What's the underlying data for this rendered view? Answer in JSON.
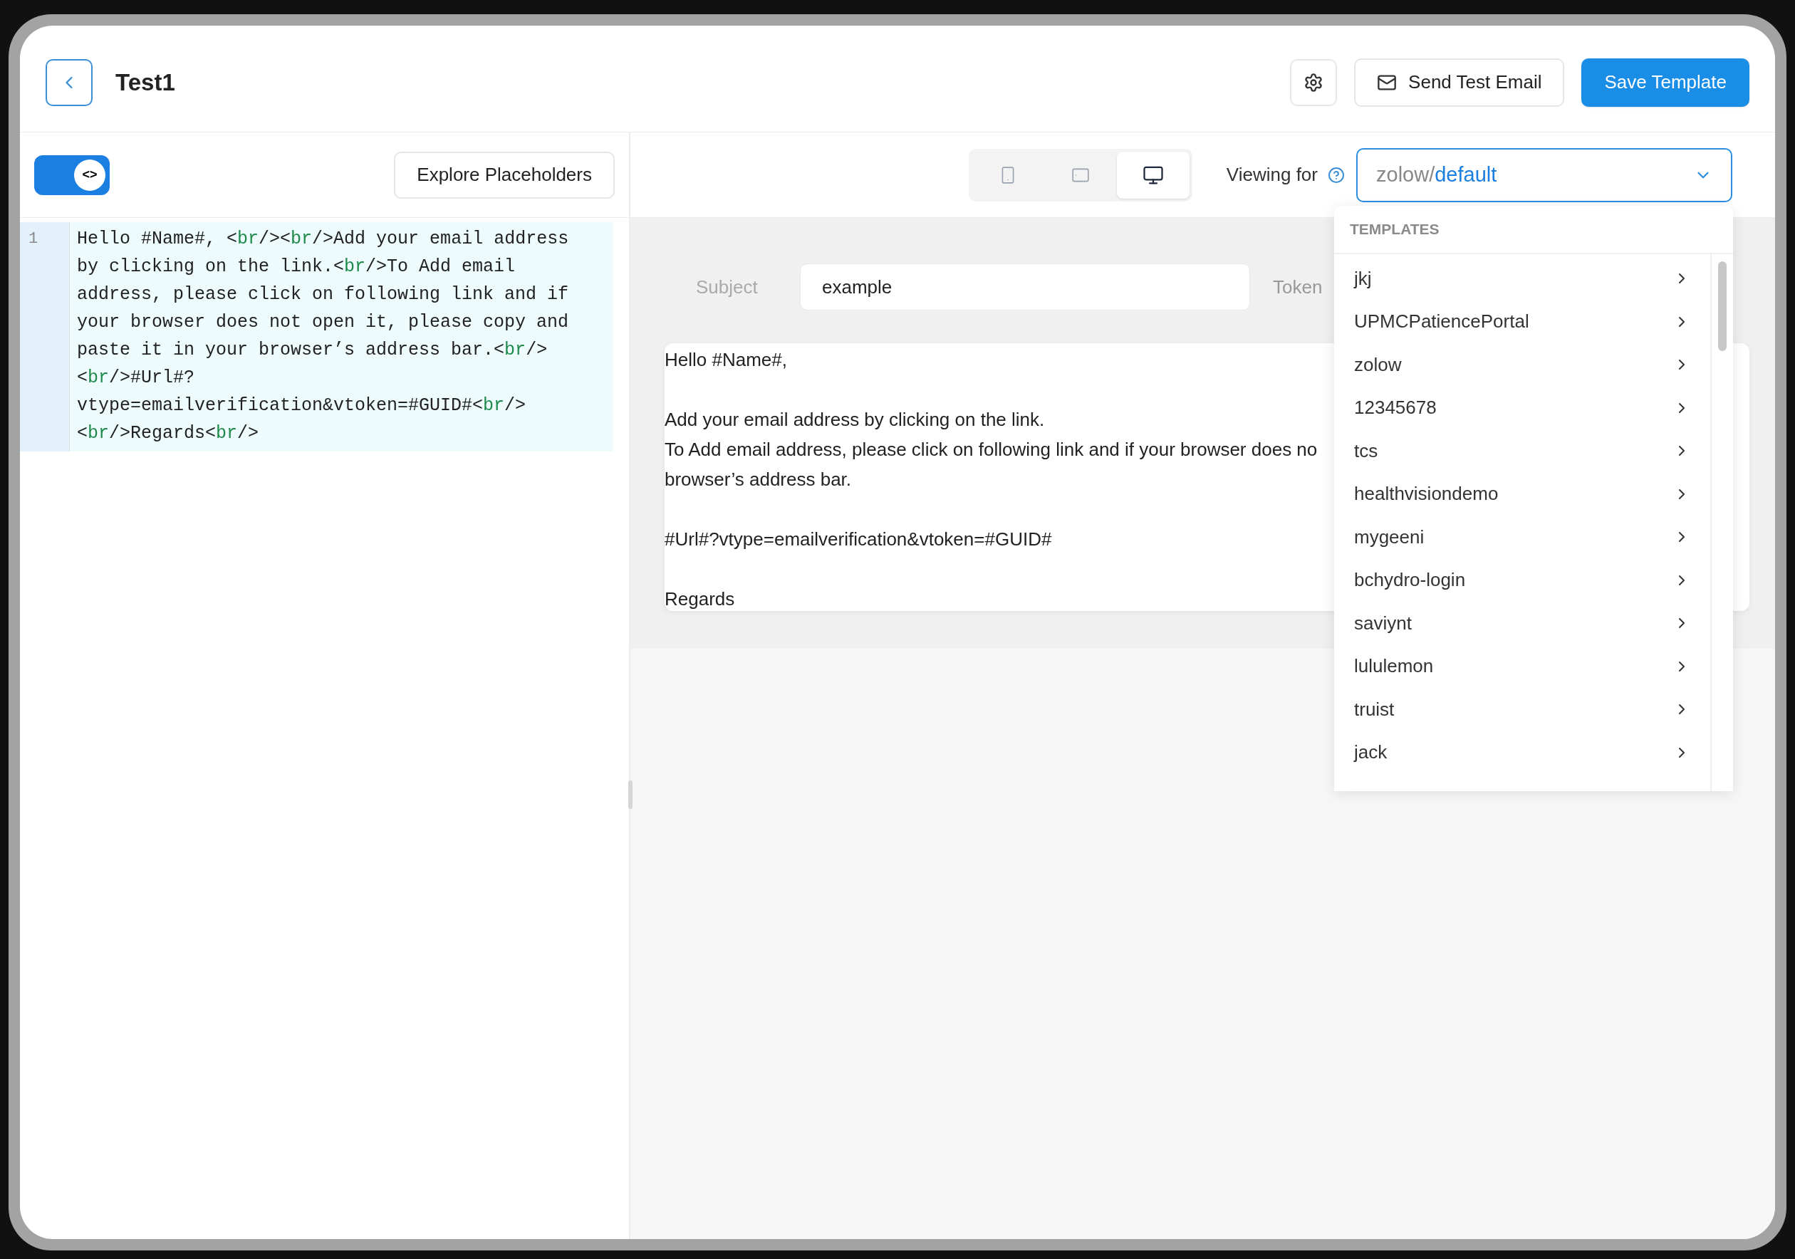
{
  "header": {
    "title": "Test1",
    "buttons": [
      {
        "label": "Send Test Email",
        "kind": "secondary"
      },
      {
        "label": "Save Template",
        "kind": "primary"
      }
    ]
  },
  "editor": {
    "toggle": {
      "label": "<>",
      "on": true
    },
    "explore_button": "Explore Placeholders",
    "line_number": "1",
    "lines": [
      [
        {
          "text": "Hello #Name#, <",
          "kind": "text"
        },
        {
          "text": "br",
          "kind": "tag"
        },
        {
          "text": "/><",
          "kind": "text"
        },
        {
          "text": "br",
          "kind": "tag"
        },
        {
          "text": "/>Add your email address",
          "kind": "text"
        }
      ],
      [
        {
          "text": "by clicking on the link.<",
          "kind": "text"
        },
        {
          "text": "br",
          "kind": "tag"
        },
        {
          "text": "/>To Add email",
          "kind": "text"
        }
      ],
      [
        {
          "text": "address, please click on following link and if",
          "kind": "text"
        }
      ],
      [
        {
          "text": "your browser does not open it, please copy and",
          "kind": "text"
        }
      ],
      [
        {
          "text": "paste it in your browser’s address bar.<",
          "kind": "text"
        },
        {
          "text": "br",
          "kind": "tag"
        },
        {
          "text": "/>",
          "kind": "text"
        }
      ],
      [
        {
          "text": "<",
          "kind": "text"
        },
        {
          "text": "br",
          "kind": "tag"
        },
        {
          "text": "/>#Url#?",
          "kind": "text"
        }
      ],
      [
        {
          "text": "vtype=emailverification&vtoken=#GUID#<",
          "kind": "text"
        },
        {
          "text": "br",
          "kind": "tag"
        },
        {
          "text": "/>",
          "kind": "text"
        }
      ],
      [
        {
          "text": "<",
          "kind": "text"
        },
        {
          "text": "br",
          "kind": "tag"
        },
        {
          "text": "/>Regards<",
          "kind": "text"
        },
        {
          "text": "br",
          "kind": "tag"
        },
        {
          "text": "/>",
          "kind": "text"
        }
      ]
    ]
  },
  "preview": {
    "devices": [
      {
        "kind": "phone",
        "selected": false
      },
      {
        "kind": "tablet",
        "selected": false
      },
      {
        "kind": "desktop",
        "selected": true
      }
    ],
    "viewing_label": "Viewing for",
    "select": {
      "prefix": "zolow/",
      "value": "default",
      "expanded": true
    },
    "subject_label": "Subject",
    "subject_value": "example",
    "token_label": "Token",
    "body": [
      [
        "Hello #Name#,"
      ],
      [
        "Add your email address by clicking on the link.",
        "To Add email address, please click on following link and if your browser does no",
        "browser’s address bar."
      ],
      [
        "#Url#?vtype=emailverification&vtoken=#GUID#"
      ],
      [
        "Regards"
      ]
    ]
  },
  "dropdown": {
    "heading": "TEMPLATES",
    "items": [
      "jkj",
      "UPMCPatiencePortal",
      "zolow",
      "12345678",
      "tcs",
      "healthvisiondemo",
      "mygeeni",
      "bchydro-login",
      "saviynt",
      "lululemon",
      "truist",
      "jack"
    ]
  }
}
